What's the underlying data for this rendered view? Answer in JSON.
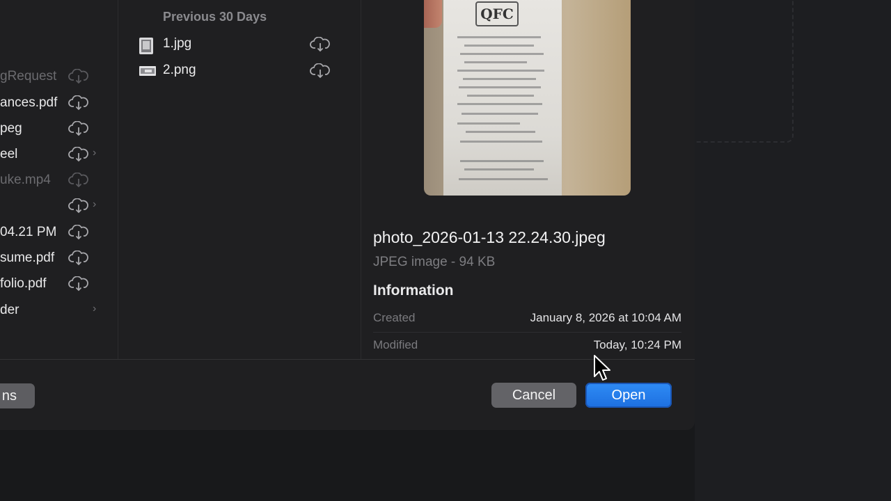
{
  "sidebar": {
    "items": [
      {
        "label": "gRequest",
        "dim": true,
        "has_cloud": true,
        "has_chevron": false
      },
      {
        "label": "ances.pdf",
        "dim": false,
        "has_cloud": true,
        "has_chevron": false
      },
      {
        "label": "peg",
        "dim": false,
        "has_cloud": true,
        "has_chevron": false
      },
      {
        "label": "eel",
        "dim": false,
        "has_cloud": true,
        "has_chevron": true
      },
      {
        "label": "uke.mp4",
        "dim": true,
        "has_cloud": true,
        "has_chevron": false
      },
      {
        "label": "",
        "dim": false,
        "has_cloud": true,
        "has_chevron": true
      },
      {
        "label": "04.21 PM",
        "dim": false,
        "has_cloud": true,
        "has_chevron": false
      },
      {
        "label": "sume.pdf",
        "dim": false,
        "has_cloud": true,
        "has_chevron": false
      },
      {
        "label": "folio.pdf",
        "dim": false,
        "has_cloud": true,
        "has_chevron": false
      },
      {
        "label": "der",
        "dim": false,
        "has_cloud": false,
        "has_chevron": true
      }
    ]
  },
  "file_list": {
    "section_title": "Previous 30 Days",
    "files": [
      {
        "name": "1.jpg",
        "icon": "jpg-file-icon"
      },
      {
        "name": "2.png",
        "icon": "png-file-icon"
      }
    ]
  },
  "preview": {
    "filename": "photo_2026-01-13 22.24.30.jpeg",
    "kind_size": "JPEG image - 94 KB",
    "receipt_logo_text": "QFC",
    "info_title": "Information",
    "rows": [
      {
        "key": "Created",
        "value": "January 8, 2026 at 10:04 AM"
      },
      {
        "key": "Modified",
        "value": "Today, 10:24 PM"
      }
    ]
  },
  "footer": {
    "left_button": "ns",
    "cancel_label": "Cancel",
    "open_label": "Open"
  },
  "colors": {
    "accent": "#1d6fe0",
    "background": "#1f1f21"
  }
}
